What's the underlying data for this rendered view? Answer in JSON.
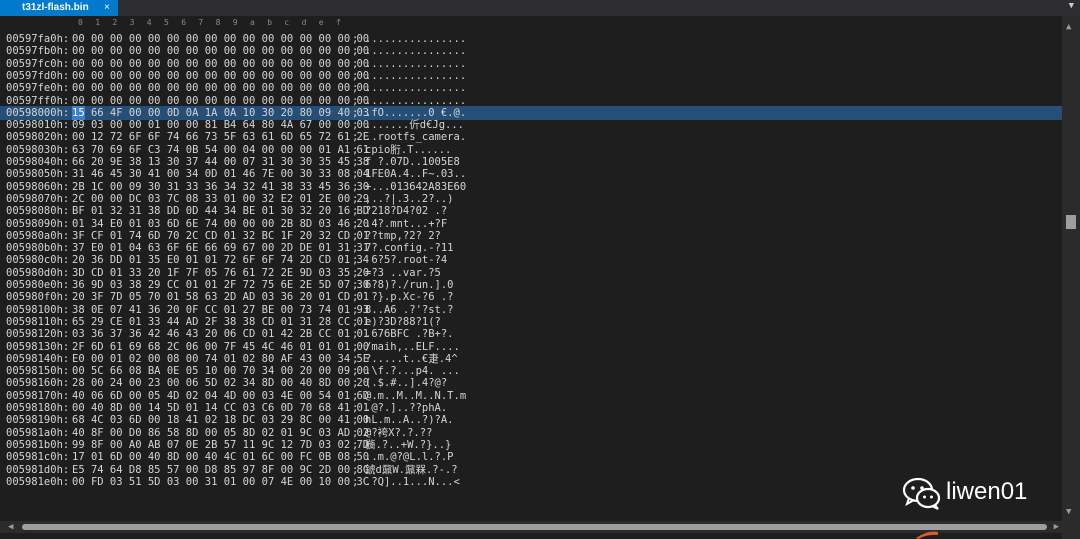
{
  "tab": {
    "title": "t31zl-flash.bin",
    "close": "×",
    "dropdown": "▼"
  },
  "ruler": [
    "0",
    "1",
    "2",
    "3",
    "4",
    "5",
    "6",
    "7",
    "8",
    "9",
    "a",
    "b",
    "c",
    "d",
    "e",
    "f"
  ],
  "rows": [
    {
      "addr": "00597fa0h:",
      "hex": "00 00 00 00 00 00 00 00 00 00 00 00 00 00 00 00",
      "ascii": "................"
    },
    {
      "addr": "00597fb0h:",
      "hex": "00 00 00 00 00 00 00 00 00 00 00 00 00 00 00 00",
      "ascii": "................"
    },
    {
      "addr": "00597fc0h:",
      "hex": "00 00 00 00 00 00 00 00 00 00 00 00 00 00 00 00",
      "ascii": "................"
    },
    {
      "addr": "00597fd0h:",
      "hex": "00 00 00 00 00 00 00 00 00 00 00 00 00 00 00 00",
      "ascii": "................"
    },
    {
      "addr": "00597fe0h:",
      "hex": "00 00 00 00 00 00 00 00 00 00 00 00 00 00 00 00",
      "ascii": "................"
    },
    {
      "addr": "00597ff0h:",
      "hex": "00 00 00 00 00 00 00 00 00 00 00 00 00 00 00 00",
      "ascii": "................"
    },
    {
      "addr": "00598000h:",
      "hex": "15 66 4F 00 00 0D 0A 1A 0A 10 30 20 80 09 40 03",
      "ascii": ".fO.......0 €.@.",
      "selected": true,
      "cursor_byte": "15"
    },
    {
      "addr": "00598010h:",
      "hex": "09 03 00 00 01 00 00 81 B4 64 80 4A 67 00 00 00",
      "ascii": ".......伒d€Jg..."
    },
    {
      "addr": "00598020h:",
      "hex": "00 12 72 6F 6F 74 66 73 5F 63 61 6D 65 72 61 2E",
      "ascii": "..rootfs_camera."
    },
    {
      "addr": "00598030h:",
      "hex": "63 70 69 6F C3 74 0B 54 00 04 00 00 00 01 A1 61",
      "ascii": "cpio胻.T......"
    },
    {
      "addr": "00598040h:",
      "hex": "66 20 9E 38 13 30 37 44 00 07 31 30 30 35 45 38",
      "ascii": "f ?.07D..1005E8"
    },
    {
      "addr": "00598050h:",
      "hex": "31 46 45 30 41 00 34 0D 01 46 7E 00 30 33 08 04",
      "ascii": "1FE0A.4..F~.03.."
    },
    {
      "addr": "00598060h:",
      "hex": "2B 1C 00 09 30 31 33 36 34 32 41 38 33 45 36 30",
      "ascii": "+...013642A83E60"
    },
    {
      "addr": "00598070h:",
      "hex": "2C 00 00 DC 03 7C 08 33 01 00 32 E2 01 2E 00 29",
      "ascii": ",..?|.3..2?..)"
    },
    {
      "addr": "00598080h:",
      "hex": "BF 01 32 31 38 DD 0D 44 34 BE 01 30 32 20 16 BD",
      "ascii": "?218?D4?02 .?"
    },
    {
      "addr": "00598090h:",
      "hex": "01 34 E0 01 03 6D 6E 74 00 00 00 2B 8D 03 46 20",
      "ascii": ".4?.mnt...+?F"
    },
    {
      "addr": "005980a0h:",
      "hex": "3F CF 01 74 6D 70 2C CD 01 32 BC 1F 20 32 CD 01",
      "ascii": "??tmp,?2? 2?"
    },
    {
      "addr": "005980b0h:",
      "hex": "37 E0 01 04 63 6F 6E 66 69 67 00 2D DE 01 31 31",
      "ascii": "7?.config.-?11"
    },
    {
      "addr": "005980c0h:",
      "hex": "20 36 DD 01 35 E0 01 01 72 6F 6F 74 2D CD 01 34",
      "ascii": " 6?5?.root-?4"
    },
    {
      "addr": "005980d0h:",
      "hex": "3D CD 01 33 20 1F 7F 05 76 61 72 2E 9D 03 35 20",
      "ascii": "=?3 ..var.?5 "
    },
    {
      "addr": "005980e0h:",
      "hex": "36 9D 03 38 29 CC 01 01 2F 72 75 6E 2E 5D 07 30",
      "ascii": "6?8)?./run.].0"
    },
    {
      "addr": "005980f0h:",
      "hex": "20 3F 7D 05 70 01 58 63 2D AD 03 36 20 01 CD 01",
      "ascii": " ?}.p.Xc-?6 .?"
    },
    {
      "addr": "00598100h:",
      "hex": "38 0E 07 41 36 20 0F CC 01 27 BE 00 73 74 01 93",
      "ascii": "8..A6 .?'?st.?"
    },
    {
      "addr": "00598110h:",
      "hex": "65 29 CE 01 33 44 AD 2F 38 38 CD 01 31 28 CC 01",
      "ascii": "e)?3D?88?1(?"
    },
    {
      "addr": "00598120h:",
      "hex": "03 36 37 36 42 46 43 20 06 CD 01 42 2B CC 01 01",
      "ascii": ".676BFC .?B+?."
    },
    {
      "addr": "00598130h:",
      "hex": "2F 6D 61 69 68 2C 06 00 7F 45 4C 46 01 01 01 00",
      "ascii": "/maih,..ELF...."
    },
    {
      "addr": "00598140h:",
      "hex": "E0 00 01 02 00 08 00 74 01 02 80 AF 43 00 34 5E",
      "ascii": "?.....t..€疌.4^"
    },
    {
      "addr": "00598150h:",
      "hex": "00 5C 66 08 BA 0E 05 10 00 70 34 00 20 00 09 00",
      "ascii": ".\\f.?...p4. ..."
    },
    {
      "addr": "00598160h:",
      "hex": "28 00 24 00 23 00 06 5D 02 34 8D 00 40 8D 00 20",
      "ascii": "(.$.#..].4?@? "
    },
    {
      "addr": "00598170h:",
      "hex": "40 06 6D 00 05 4D 02 04 4D 00 03 4E 00 54 01 6D",
      "ascii": "@.m..M..M..N.T.m"
    },
    {
      "addr": "00598180h:",
      "hex": "00 40 8D 00 14 5D 01 14 CC 03 C6 0D 70 68 41 01",
      "ascii": ".@?.]..??phA."
    },
    {
      "addr": "00598190h:",
      "hex": "68 4C 03 6D 00 18 41 02 18 DC 03 29 8C 00 41 00",
      "ascii": "hL.m..A..?)?A."
    },
    {
      "addr": "005981a0h:",
      "hex": "40 8F 00 D0 86 58 8D 00 05 8D 02 01 9C 03 AD 02",
      "ascii": "@?袴X?.?.??"
    },
    {
      "addr": "005981b0h:",
      "hex": "99 8F 00 A0 AB 07 0E 2B 57 11 9C 12 7D 03 02 7D",
      "ascii": "檹.?..+W.?}..}"
    },
    {
      "addr": "005981c0h:",
      "hex": "17 01 6D 00 40 8D 00 40 4C 01 6C 00 FC 0B 08 50",
      "ascii": "..m.@?@L.l.?.P"
    },
    {
      "addr": "005981d0h:",
      "hex": "E5 74 64 D8 85 57 00 D8 85 97 8F 00 9C 2D 00 8C",
      "ascii": "錿d鼐W.鼐槑.?-.?"
    },
    {
      "addr": "005981e0h:",
      "hex": "00 FD 03 51 5D 03 00 31 01 00 07 4E 00 10 00 3C",
      "ascii": ".?Q]..1...N...<"
    }
  ],
  "watermark": {
    "text": "liwen01",
    "icon": "wechat-icon"
  },
  "scrollbar": {
    "vertical_position": 0.39
  },
  "colors": {
    "tab": "#007acc",
    "selection": "#264f78",
    "cursor": "#3b7fd1",
    "background": "#1e1e1e"
  }
}
